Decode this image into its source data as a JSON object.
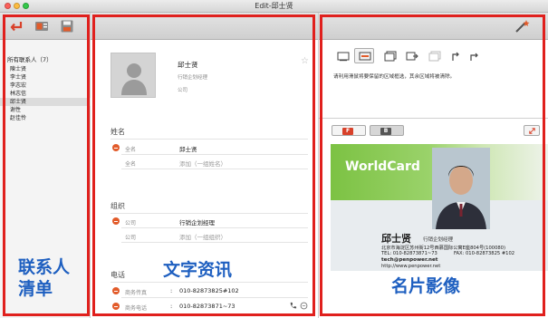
{
  "window": {
    "title": "Edit-邱士贤"
  },
  "contacts": {
    "header": "所有联系人（7）",
    "items": [
      "陳士贤",
      "李士贤",
      "李志宏",
      "林志信",
      "邱士贤",
      "谢性",
      "赵佳怜"
    ],
    "selected_index": 4
  },
  "detail": {
    "name": "邱士贤",
    "title": "行销企划经理",
    "company_placeholder": "公司",
    "name_section": {
      "title": "姓名",
      "fields": [
        {
          "label": "全名",
          "value": "邱士贤"
        },
        {
          "label": "全名",
          "placeholder": "添加（一组姓名）"
        }
      ]
    },
    "org_section": {
      "title": "组织",
      "fields": [
        {
          "label": "公司",
          "value": "行销企划经理"
        },
        {
          "label": "公司",
          "placeholder": "添加（一组组织）"
        }
      ]
    },
    "phone_section": {
      "title": "电话",
      "fields": [
        {
          "label": "商务传真",
          "value": "010-82873825#102"
        },
        {
          "label": "商务电话",
          "value": "010-82873871~73"
        }
      ]
    }
  },
  "preview": {
    "notice": "请利用滑鼠将要保留的区域框选，其余区域将被清除。",
    "tabs": [
      {
        "label": "F",
        "active": true
      },
      {
        "label": "B",
        "active": false
      }
    ],
    "card": {
      "brand": "WorldCard",
      "name": "邱士贤",
      "job": "行销企划经理",
      "address": "北京市海淀区苏州街12号西慕国际公寓E座804号(100080)",
      "tel": "TEL: 010-82873871~73",
      "fax": "FAX: 010-82873825 #102",
      "email": "tech@penpower.net",
      "web": "http://www.penpower.net"
    }
  },
  "overlays": {
    "left": "联系人\n清单",
    "mid": "文字资讯",
    "right": "名片影像"
  },
  "colors": {
    "frame": "#e0201d",
    "label": "#1e5fc0",
    "accent": "#e25b2a"
  }
}
